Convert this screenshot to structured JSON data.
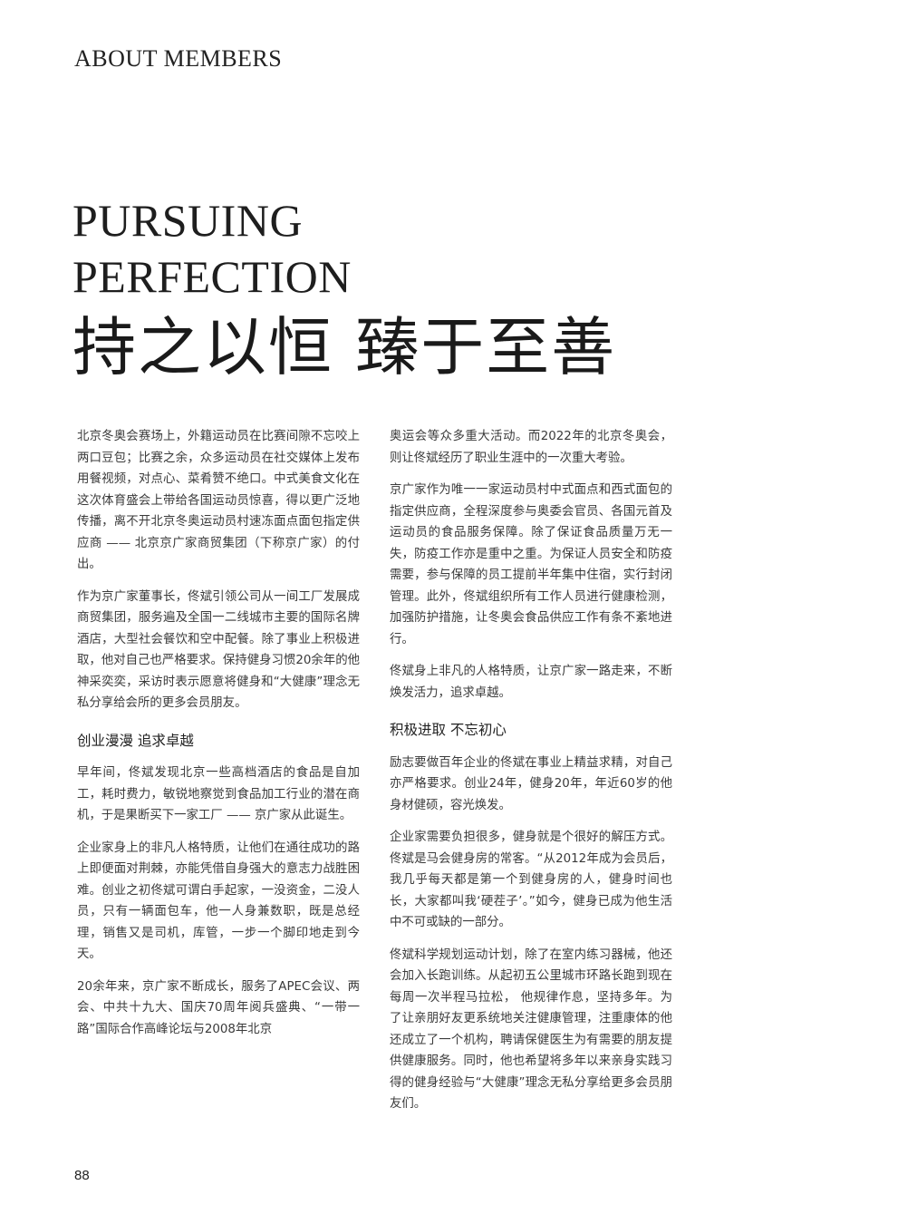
{
  "header": {
    "section_label": "ABOUT MEMBERS"
  },
  "title": {
    "en_line1": "PURSUING",
    "en_line2": "PERFECTION",
    "cn": "持之以恒  臻于至善"
  },
  "left_column": {
    "p1": "北京冬奥会赛场上，外籍运动员在比赛间隙不忘咬上两口豆包；比赛之余，众多运动员在社交媒体上发布用餐视频，对点心、菜肴赞不绝口。中式美食文化在这次体育盛会上带给各国运动员惊喜，得以更广泛地传播，离不开北京冬奥运动员村速冻面点面包指定供应商 —— 北京京广家商贸集团（下称京广家）的付出。",
    "p2": "作为京广家董事长，佟斌引领公司从一间工厂发展成商贸集团，服务遍及全国一二线城市主要的国际名牌酒店，大型社会餐饮和空中配餐。除了事业上积极进取，他对自己也严格要求。保持健身习惯20余年的他神采奕奕，采访时表示愿意将健身和“大健康”理念无私分享给会所的更多会员朋友。",
    "h1": "创业漫漫 追求卓越",
    "p3": "早年间，佟斌发现北京一些高档酒店的食品是自加工，耗时费力，敏锐地察觉到食品加工行业的潜在商机，于是果断买下一家工厂 —— 京广家从此诞生。",
    "p4": "企业家身上的非凡人格特质，让他们在通往成功的路上即便面对荆棘，亦能凭借自身强大的意志力战胜困难。创业之初佟斌可谓白手起家，一没资金，二没人员，只有一辆面包车，他一人身兼数职，既是总经理，销售又是司机，库管，一步一个脚印地走到今天。",
    "p5": "20余年来，京广家不断成长，服务了APEC会议、两会、中共十九大、国庆70周年阅兵盛典、“一带一路”国际合作高峰论坛与2008年北京"
  },
  "right_column": {
    "p1": "奥运会等众多重大活动。而2022年的北京冬奥会，则让佟斌经历了职业生涯中的一次重大考验。",
    "p2": "京广家作为唯一一家运动员村中式面点和西式面包的指定供应商，全程深度参与奥委会官员、各国元首及运动员的食品服务保障。除了保证食品质量万无一失，防疫工作亦是重中之重。为保证人员安全和防疫需要，参与保障的员工提前半年集中住宿，实行封闭管理。此外，佟斌组织所有工作人员进行健康检测，加强防护措施，让冬奥会食品供应工作有条不紊地进行。",
    "p3": "佟斌身上非凡的人格特质，让京广家一路走来，不断焕发活力，追求卓越。",
    "h1": "积极进取 不忘初心",
    "p4": "励志要做百年企业的佟斌在事业上精益求精，对自己亦严格要求。创业24年，健身20年，年近60岁的他身材健硕，容光焕发。",
    "p5": "企业家需要负担很多，健身就是个很好的解压方式。佟斌是马会健身房的常客。“从2012年成为会员后，我几乎每天都是第一个到健身房的人，健身时间也长，大家都叫我‘硬茬子’。”如今，健身已成为他生活中不可或缺的一部分。",
    "p6": "佟斌科学规划运动计划，除了在室内练习器械，他还会加入长跑训练。从起初五公里城市环路长跑到现在每周一次半程马拉松， 他规律作息，坚持多年。为了让亲朋好友更系统地关注健康管理，注重康体的他还成立了一个机构，聘请保健医生为有需要的朋友提供健康服务。同时，他也希望将多年以来亲身实践习得的健身经验与“大健康”理念无私分享给更多会员朋友们。"
  },
  "footer": {
    "page_number": "88"
  }
}
